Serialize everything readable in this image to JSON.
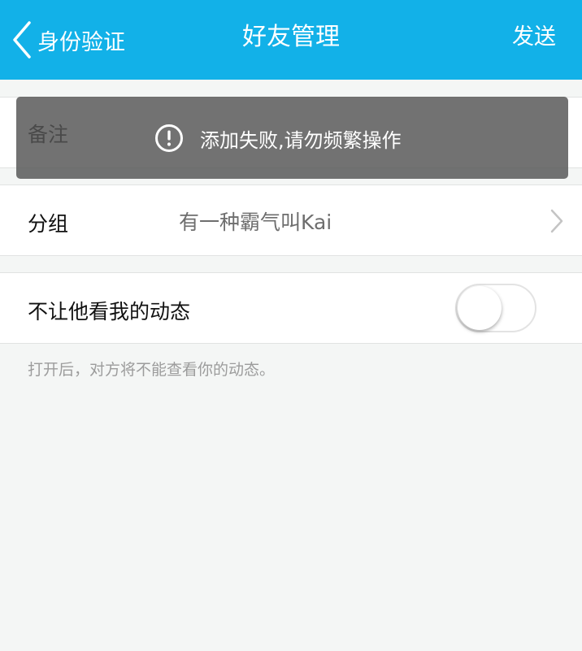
{
  "header": {
    "back_label": "身份验证",
    "title": "好友管理",
    "send_label": "发送"
  },
  "remark": {
    "label": "备注"
  },
  "group": {
    "label": "分组",
    "value": "有一种霸气叫Kai"
  },
  "privacy": {
    "label": "不让他看我的动态",
    "toggle_on": false,
    "hint": "打开后，对方将不能查看你的动态。"
  },
  "toast": {
    "icon": "exclamation-circle-icon",
    "message": "添加失败,请勿频繁操作"
  },
  "colors": {
    "header_bg": "#12b1e8",
    "page_bg": "#f4f6f5",
    "toast_bg": "#555555"
  }
}
